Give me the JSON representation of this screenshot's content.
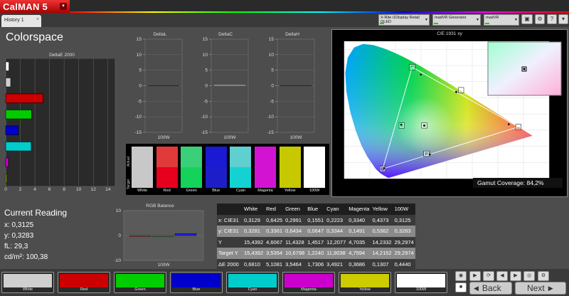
{
  "app": {
    "logo": "CalMAN 5",
    "logo_drop": "▾",
    "tab": "History 1"
  },
  "devices": [
    {
      "name": "X-Rite i1Display Retail OLED"
    },
    {
      "name": "madVR Generator"
    },
    {
      "name": "madVR"
    }
  ],
  "page_title": "Colorspace",
  "graph_titles": {
    "de2000": "DeltaE 2000",
    "deltaL": "DeltaL",
    "deltaC": "DeltaC",
    "deltaH": "DeltaH",
    "cie": "CIE 1931 xy",
    "rgb": "RGB Balance"
  },
  "swatch_axis": {
    "actual": "Actual",
    "target": "Target"
  },
  "gamut": {
    "label": "Gamut Coverage:",
    "value": "84,2%"
  },
  "current_reading": {
    "heading": "Current Reading",
    "lines": [
      "x: 0,3125",
      "y: 0,3283",
      "fL: 29,3",
      "cd/m²: 100,38"
    ]
  },
  "table": {
    "headers": [
      "",
      "White",
      "Red",
      "Green",
      "Blue",
      "Cyan",
      "Magenta",
      "Yellow",
      "100W"
    ],
    "rows": [
      [
        "x: CIE31",
        "0,3129",
        "0,6425",
        "0,2991",
        "0,1551",
        "0,2223",
        "0,3340",
        "0,4373",
        "0,3125"
      ],
      [
        "y: CIE31",
        "0,3281",
        "0,3361",
        "0,6434",
        "0,0647",
        "0,3344",
        "0,1491",
        "0,5362",
        "0,3283"
      ],
      [
        "Y",
        "15,4392",
        "4,6067",
        "11,4328",
        "1,4517",
        "12,2077",
        "4,7035",
        "14,2332",
        "29,2974"
      ],
      [
        "Target Y",
        "15,4392",
        "3,5354",
        "10,6798",
        "1,2240",
        "11,9038",
        "4,7594",
        "14,2152",
        "29,2974"
      ],
      [
        "ΔE 2000",
        "0,6810",
        "5,1081",
        "3,5464",
        "1,7306",
        "3,4921",
        "0,3686",
        "0,1307",
        "0,4440"
      ]
    ]
  },
  "patches": [
    {
      "name": "White",
      "actual": "#c8c8c8",
      "target": "#c8c8c8"
    },
    {
      "name": "Red",
      "actual": "#e03a3a",
      "target": "#e6001e"
    },
    {
      "name": "Green",
      "actual": "#3ad07a",
      "target": "#14d25a"
    },
    {
      "name": "Blue",
      "actual": "#1a1ad2",
      "target": "#1e1ec8"
    },
    {
      "name": "Cyan",
      "actual": "#5fcfcf",
      "target": "#14d2d2"
    },
    {
      "name": "Magenta",
      "actual": "#d214d2",
      "target": "#d214d2"
    },
    {
      "name": "Yellow",
      "actual": "#c8c800",
      "target": "#c8c800"
    },
    {
      "name": "100W",
      "actual": "#ffffff",
      "target": "#ffffff"
    }
  ],
  "colors": {
    "accent": "#cc2222",
    "White": "#cfcfcf",
    "Red": "#cc0000",
    "Green": "#00cc00",
    "Blue": "#0000cc",
    "Cyan": "#00cccc",
    "Magenta": "#cc00cc",
    "Yellow": "#cccc00",
    "100W": "#ffffff"
  },
  "nav": {
    "back": "Back",
    "next": "Next"
  },
  "chart_data": [
    {
      "type": "bar",
      "title": "DeltaE 2000",
      "orientation": "horizontal",
      "categories": [
        "100W",
        "White",
        "Red",
        "Green",
        "Blue",
        "Cyan",
        "Magenta",
        "Yellow"
      ],
      "values": [
        0.444,
        0.681,
        5.1081,
        3.5464,
        1.7306,
        3.4921,
        0.3686,
        0.1307
      ],
      "xlim": [
        0,
        15
      ],
      "xticks": [
        "0",
        "2",
        "4",
        "6",
        "8",
        "10",
        "12",
        "14"
      ],
      "grid": true
    },
    {
      "type": "bar",
      "title": "DeltaL",
      "categories": [
        "100W"
      ],
      "values": [
        0
      ],
      "ylim": [
        -15,
        15
      ],
      "yticks": [
        "15",
        "10",
        "5",
        "0",
        "-5",
        "-10",
        "-15"
      ],
      "xlabel": "100W",
      "grid": true
    },
    {
      "type": "bar",
      "title": "DeltaC",
      "categories": [
        "100W"
      ],
      "values": [
        0.3
      ],
      "ylim": [
        -15,
        15
      ],
      "yticks": [
        "15",
        "10",
        "5",
        "0",
        "-5",
        "-10",
        "-15"
      ],
      "xlabel": "100W",
      "grid": true
    },
    {
      "type": "bar",
      "title": "DeltaH",
      "categories": [
        "100W"
      ],
      "values": [
        0
      ],
      "ylim": [
        -15,
        15
      ],
      "yticks": [
        "15",
        "10",
        "5",
        "0",
        "-5",
        "-10",
        "-15"
      ],
      "xlabel": "100W",
      "grid": true
    },
    {
      "type": "scatter",
      "title": "CIE 1931 xy",
      "xlim": [
        0,
        0.8
      ],
      "ylim": [
        0,
        0.85
      ],
      "xticks": [
        "0",
        "0,1",
        "0,2",
        "0,3",
        "0,4",
        "0,5",
        "0,6",
        "0,7"
      ],
      "yticks": [
        "0,8",
        "0,7",
        "0,6",
        "0,5",
        "0,4",
        "0,3",
        "0,2",
        "0,1",
        "0"
      ],
      "targets": {
        "red": [
          0.68,
          0.32
        ],
        "green": [
          0.265,
          0.69
        ],
        "blue": [
          0.15,
          0.06
        ],
        "white": [
          0.3127,
          0.329
        ],
        "cyan": [
          0.2246,
          0.3287
        ],
        "magenta": [
          0.3209,
          0.1542
        ],
        "yellow": [
          0.4562,
          0.5473
        ]
      },
      "measured": [
        {
          "name": "White",
          "x": 0.3129,
          "y": 0.3281
        },
        {
          "name": "Red",
          "x": 0.6425,
          "y": 0.3361
        },
        {
          "name": "Green",
          "x": 0.2991,
          "y": 0.6434
        },
        {
          "name": "Blue",
          "x": 0.1551,
          "y": 0.0647
        },
        {
          "name": "Cyan",
          "x": 0.2223,
          "y": 0.3344
        },
        {
          "name": "Magenta",
          "x": 0.334,
          "y": 0.1491
        },
        {
          "name": "Yellow",
          "x": 0.4373,
          "y": 0.5362
        },
        {
          "name": "100W",
          "x": 0.3125,
          "y": 0.3283
        }
      ]
    },
    {
      "type": "bar",
      "title": "RGB Balance",
      "categories": [
        "100W"
      ],
      "series": [
        {
          "name": "R",
          "values": [
            -0.3
          ]
        },
        {
          "name": "G",
          "values": [
            -0.2
          ]
        },
        {
          "name": "B",
          "values": [
            0.8
          ]
        }
      ],
      "ylim": [
        -10,
        10
      ],
      "yticks": [
        "10",
        "0",
        "-10"
      ],
      "xlabel": "100W",
      "grid": true
    }
  ]
}
